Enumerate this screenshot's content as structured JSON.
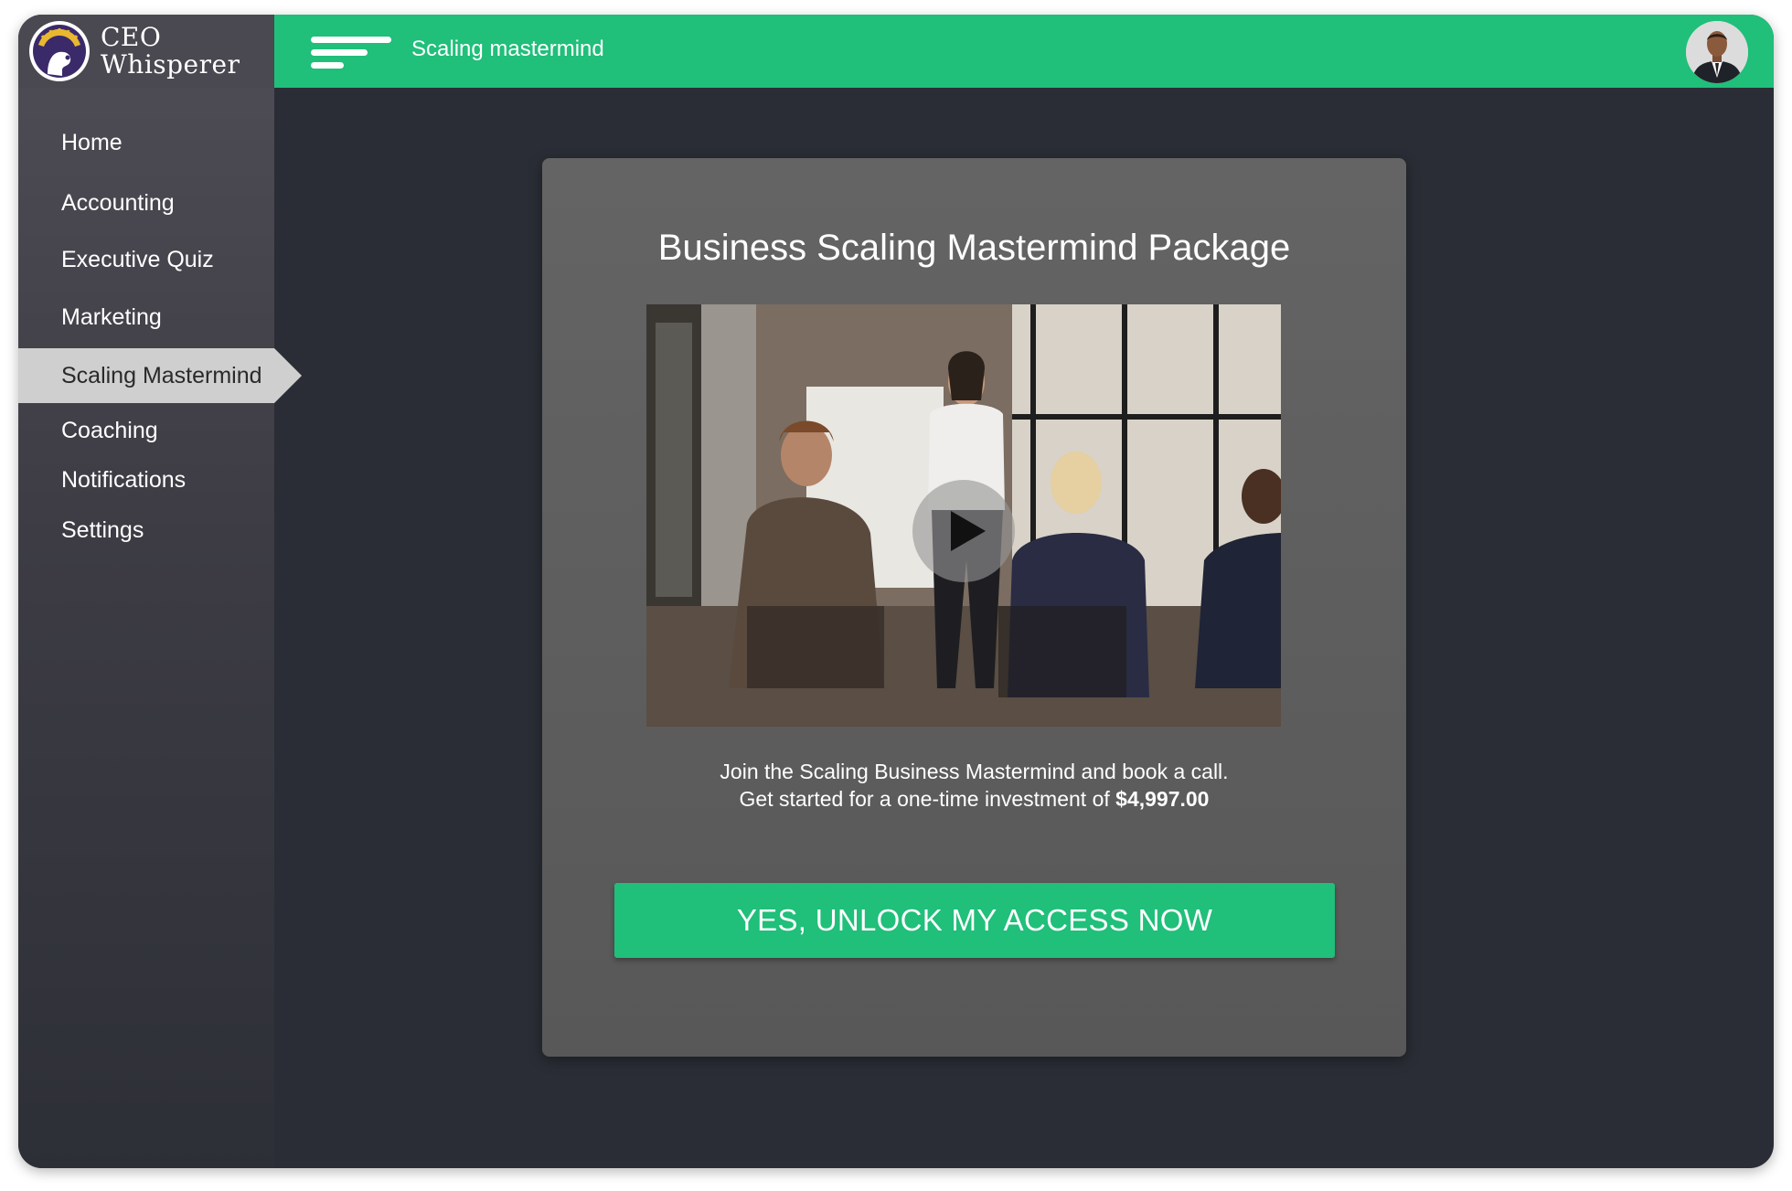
{
  "brand": {
    "name_line1": "CEO",
    "name_line2": "Whisperer",
    "logo_icon": "ceo-whisperer-logo"
  },
  "sidebar": {
    "items": [
      {
        "label": "Home",
        "active": false
      },
      {
        "label": "Accounting",
        "active": false
      },
      {
        "label": "Executive Quiz",
        "active": false
      },
      {
        "label": "Marketing",
        "active": false
      },
      {
        "label": "Scaling Mastermind",
        "active": true
      },
      {
        "label": "Coaching",
        "active": false
      },
      {
        "label": "Notifications",
        "active": false
      },
      {
        "label": "Settings",
        "active": false
      }
    ]
  },
  "header": {
    "title": "Scaling mastermind",
    "menu_icon": "hamburger-menu-icon",
    "avatar_icon": "user-avatar"
  },
  "main": {
    "card_title": "Business Scaling Mastermind Package",
    "video_icon": "play-icon",
    "description_line1": "Join the Scaling Business Mastermind and book a call.",
    "description_line2_prefix": "Get started for a one-time investment of",
    "price": "$4,997.00",
    "cta_label": "YES, UNLOCK MY ACCESS NOW"
  },
  "colors": {
    "accent_green": "#20bf7a",
    "background_dark": "#2a2d35",
    "card_gray": "#5e5e5e",
    "active_nav": "#cfcfcf"
  }
}
